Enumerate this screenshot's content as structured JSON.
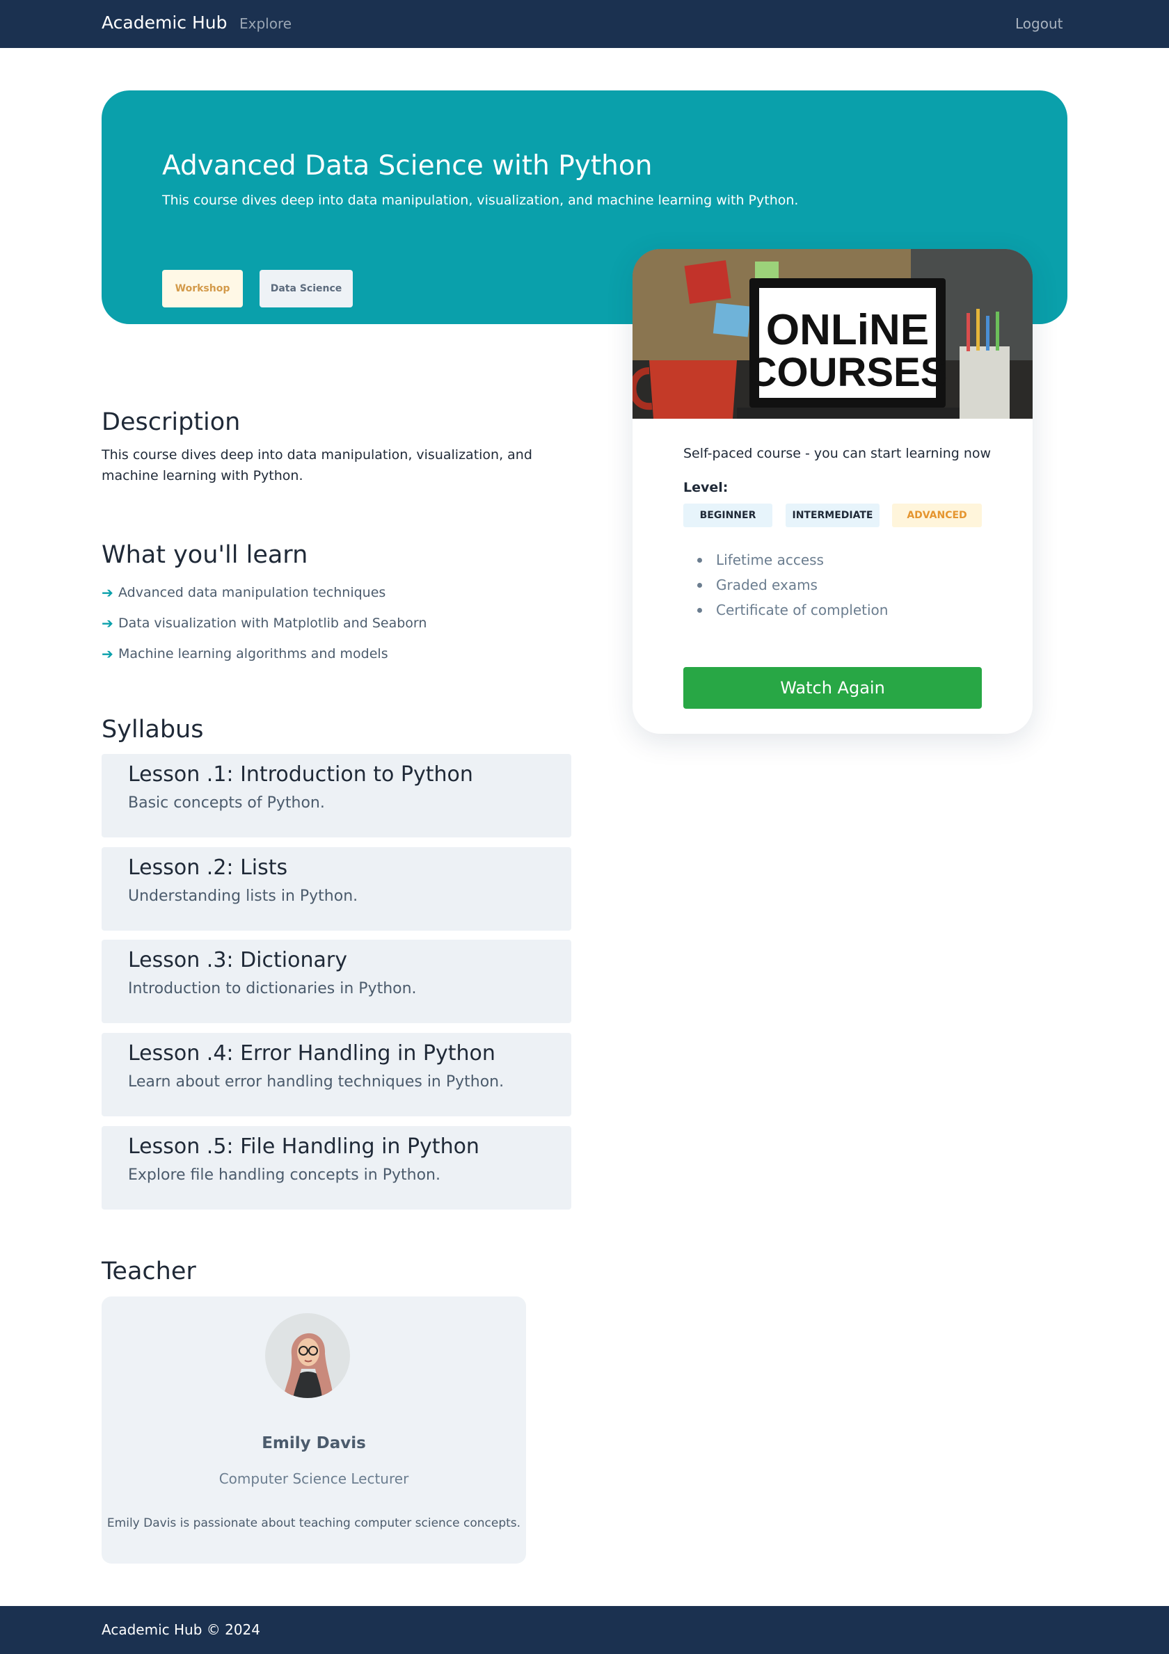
{
  "nav": {
    "brand": "Academic Hub",
    "explore": "Explore",
    "logout": "Logout"
  },
  "hero": {
    "title": "Advanced Data Science with Python",
    "subtitle": "This course dives deep into data manipulation, visualization, and machine learning with Python.",
    "tags": [
      "Workshop",
      "Data Science"
    ]
  },
  "card": {
    "image_text": [
      "ONLiNE",
      "COURSES"
    ],
    "self_paced": "Self-paced course - you can start learning now",
    "level_label": "Level:",
    "levels": [
      "BEGINNER",
      "INTERMEDIATE",
      "ADVANCED"
    ],
    "features": [
      "Lifetime access",
      "Graded exams",
      "Certificate of completion"
    ],
    "button": "Watch Again"
  },
  "description": {
    "title": "Description",
    "text": "This course dives deep into data manipulation, visualization, and machine learning with Python."
  },
  "learn": {
    "title": "What you'll learn",
    "items": [
      "Advanced data manipulation techniques",
      "Data visualization with Matplotlib and Seaborn",
      "Machine learning algorithms and models"
    ]
  },
  "syllabus": {
    "title": "Syllabus",
    "lessons": [
      {
        "title": "Lesson .1: Introduction to Python",
        "desc": "Basic concepts of Python."
      },
      {
        "title": "Lesson .2: Lists",
        "desc": "Understanding lists in Python."
      },
      {
        "title": "Lesson .3: Dictionary",
        "desc": "Introduction to dictionaries in Python."
      },
      {
        "title": "Lesson .4: Error Handling in Python",
        "desc": "Learn about error handling techniques in Python."
      },
      {
        "title": "Lesson .5: File Handling in Python",
        "desc": "Explore file handling concepts in Python."
      }
    ]
  },
  "teacher": {
    "title": "Teacher",
    "name": "Emily Davis",
    "role": "Computer Science Lecturer",
    "bio": "Emily Davis is passionate about teaching computer science concepts."
  },
  "footer": {
    "text": "Academic Hub © 2024"
  },
  "colors": {
    "navy": "#1b3150",
    "teal": "#0aa0ab",
    "green_button": "#28a745",
    "lesson_bg": "#edf1f5",
    "advanced_badge": "#e5952f"
  }
}
